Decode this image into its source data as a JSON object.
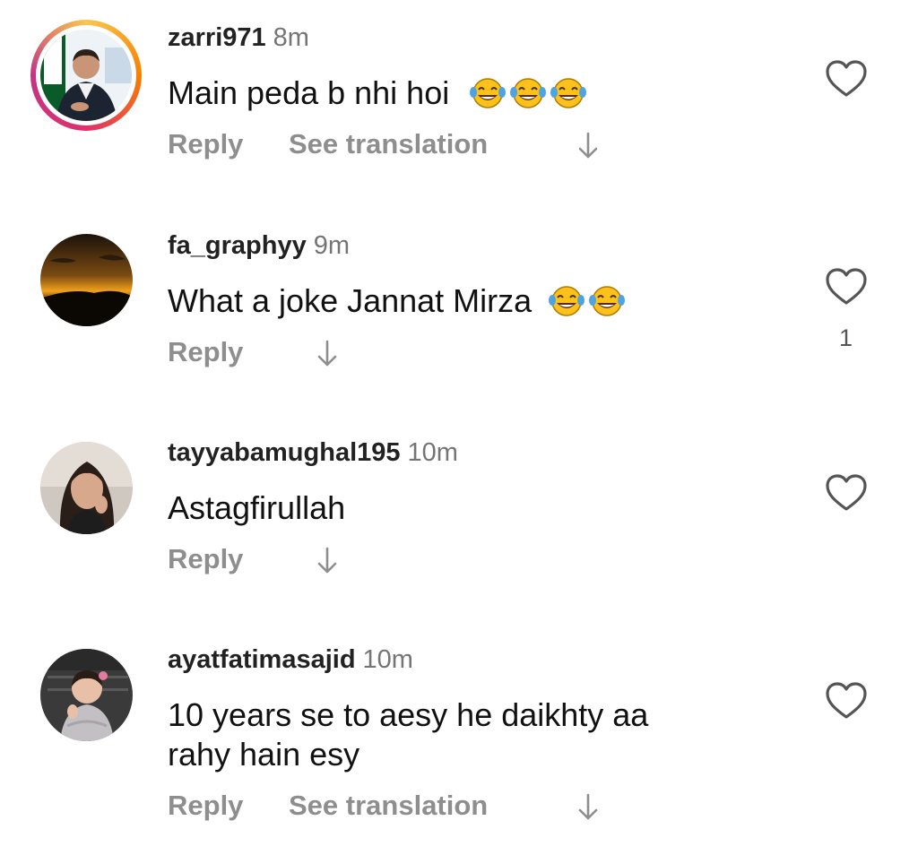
{
  "comments": [
    {
      "username": "zarri971",
      "time": "8m",
      "text": "Main peda b nhi hoi",
      "emojis": [
        "face-with-tears-of-joy",
        "face-with-tears-of-joy",
        "face-with-tears-of-joy"
      ],
      "reply_label": "Reply",
      "translation_label": "See translation",
      "like_count": "",
      "avatar": "story-ring-avatar"
    },
    {
      "username": "fa_graphyy",
      "time": "9m",
      "text": "What a joke Jannat Mirza",
      "emojis": [
        "face-with-tears-of-joy",
        "face-with-tears-of-joy"
      ],
      "reply_label": "Reply",
      "translation_label": "",
      "like_count": "1",
      "avatar": "sunset-avatar"
    },
    {
      "username": "tayyabamughal195",
      "time": "10m",
      "text": "Astagfirullah",
      "emojis": [],
      "reply_label": "Reply",
      "translation_label": "",
      "like_count": "",
      "avatar": "portrait-avatar"
    },
    {
      "username": "ayatfatimasajid",
      "time": "10m",
      "text": "10 years se to aesy he daikhty aa rahy hain esy",
      "emojis": [],
      "reply_label": "Reply",
      "translation_label": "See translation",
      "like_count": "",
      "avatar": "child-avatar"
    }
  ],
  "icons": {
    "like": "heart-outline-icon",
    "translate": "arrow-down-icon"
  },
  "colors": {
    "text": "#111111",
    "secondary": "#8e8e8e",
    "time": "#757575",
    "emoji_face": "#fcc21b"
  }
}
